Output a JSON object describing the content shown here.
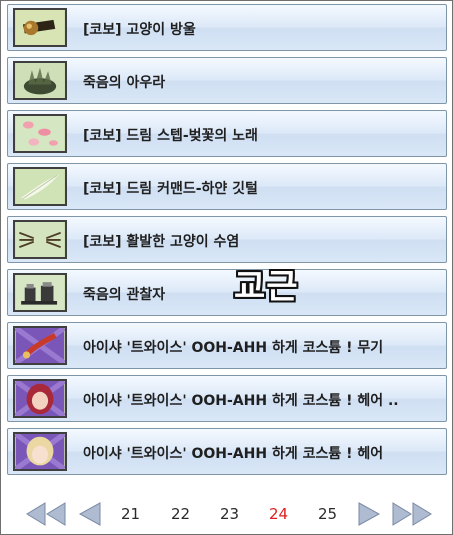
{
  "items": [
    {
      "label": "[코보] 고양이 방울",
      "icon": "cat-bell-icon"
    },
    {
      "label": "죽음의 아우라",
      "icon": "death-aura-icon"
    },
    {
      "label": "[코보] 드림 스텝-벚꽃의 노래",
      "icon": "cherry-blossom-icon"
    },
    {
      "label": "[코보] 드림 커맨드-하얀 깃털",
      "icon": "white-feather-icon"
    },
    {
      "label": "[코보] 활발한 고양이 수염",
      "icon": "cat-whiskers-icon"
    },
    {
      "label": "죽음의 관찰자",
      "icon": "death-observer-icon"
    },
    {
      "label": "아이샤 '트와이스' OOH-AHH 하게 코스튬 ! 무기",
      "icon": "weapon-costume-icon"
    },
    {
      "label": "아이샤 '트와이스' OOH-AHH 하게 코스튬 ! 헤어 ..",
      "icon": "hair-red-icon"
    },
    {
      "label": "아이샤 '트와이스' OOH-AHH 하게 코스튬 ! 헤어",
      "icon": "hair-blonde-icon"
    }
  ],
  "overlay_text": "교근",
  "pagination": {
    "pages": [
      "21",
      "22",
      "23",
      "24",
      "25"
    ],
    "current": "24"
  }
}
